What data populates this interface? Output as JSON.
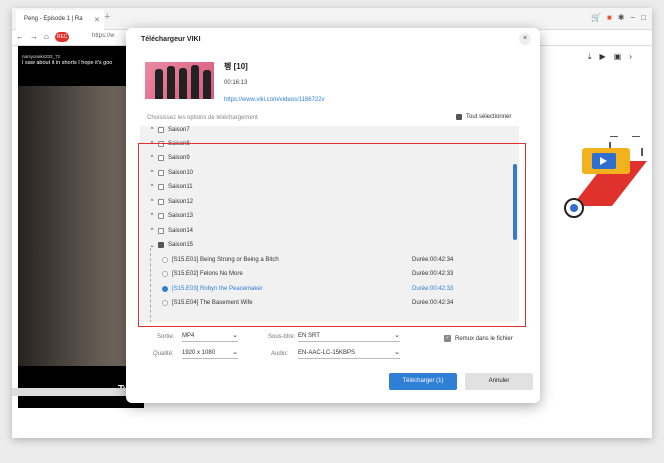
{
  "browser": {
    "tab_title": "Peng - Episode 1 | Ra",
    "url": "https://w",
    "rec_label": "REC"
  },
  "video": {
    "username": "narsyonaks333_72",
    "caption": "I saw about it in shorts I hope it's goo",
    "bottom_text": "Two"
  },
  "modal": {
    "title": "Téléchargeur  VIKI",
    "close": "×",
    "episode_title": "펭 [10]",
    "duration": "00:16:13",
    "link": "https://www.viki.com/videos/1186722v",
    "options_label": "Choisissez les options de téléchargement",
    "select_all": "Tout sélectionner",
    "seasons": [
      {
        "label": "Saison7",
        "expanded": false
      },
      {
        "label": "Saison8",
        "expanded": false
      },
      {
        "label": "Saison9",
        "expanded": false
      },
      {
        "label": "Saison10",
        "expanded": false
      },
      {
        "label": "Saison11",
        "expanded": false
      },
      {
        "label": "Saison12",
        "expanded": false
      },
      {
        "label": "Saison13",
        "expanded": false
      },
      {
        "label": "Saison14",
        "expanded": false
      },
      {
        "label": "Saison15",
        "expanded": true
      }
    ],
    "episodes": [
      {
        "title": "[S15.E01] Being Strong or Being a Bitch",
        "duration": "Durée:00:42:34",
        "selected": false
      },
      {
        "title": "[S15.E02] Felons No More",
        "duration": "Durée:00:42:33",
        "selected": false
      },
      {
        "title": "[S15.E03] Robyn the Peacemaker",
        "duration": "Durée:00:42:33",
        "selected": true
      },
      {
        "title": "[S15.E04] The Basement Wife",
        "duration": "Durée:00:42:34",
        "selected": false
      }
    ],
    "form": {
      "sortie_label": "Sortie:",
      "sortie_value": "MP4",
      "soustitre_label": "Sous-titre:",
      "soustitre_value": "EN SRT",
      "qualite_label": "Qualité:",
      "qualite_value": "1920 x 1080",
      "audio_label": "Audio:",
      "audio_value": "EN-AAC-LC-15KBPS",
      "remux_label": "Remux dans le fichier"
    },
    "download_button": "Télécharger (1)",
    "cancel_button": "Annuler"
  },
  "colors": {
    "accent": "#2f7fd6",
    "highlight_box": "#e0322c"
  }
}
